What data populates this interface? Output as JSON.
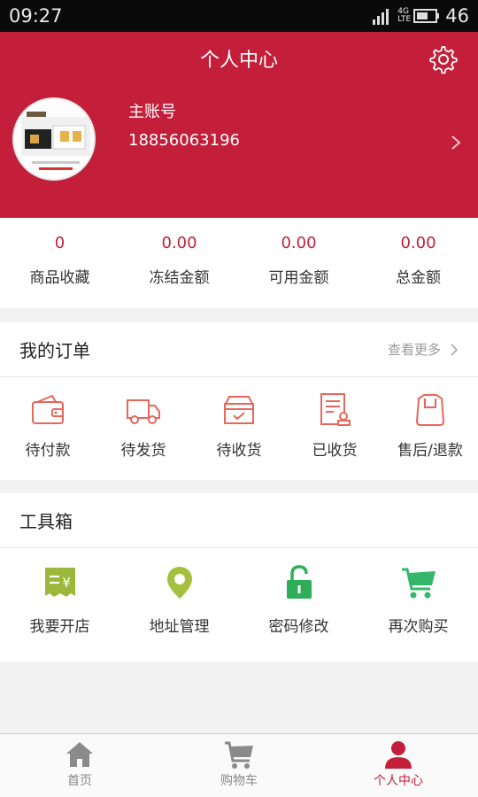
{
  "status_bar": {
    "time": "09:27",
    "network": "4G LTE",
    "battery": "46"
  },
  "header": {
    "title": "个人中心",
    "account_label": "主账号",
    "phone": "18856063196"
  },
  "stats": [
    {
      "value": "0",
      "label": "商品收藏"
    },
    {
      "value": "0.00",
      "label": "冻结金额"
    },
    {
      "value": "0.00",
      "label": "可用金额"
    },
    {
      "value": "0.00",
      "label": "总金额"
    }
  ],
  "orders": {
    "title": "我的订单",
    "more": "查看更多",
    "items": [
      {
        "label": "待付款",
        "icon": "wallet-icon"
      },
      {
        "label": "待发货",
        "icon": "truck-icon"
      },
      {
        "label": "待收货",
        "icon": "box-icon"
      },
      {
        "label": "已收货",
        "icon": "receipt-icon"
      },
      {
        "label": "售后/退款",
        "icon": "return-bag-icon"
      }
    ]
  },
  "tools": {
    "title": "工具箱",
    "items": [
      {
        "label": "我要开店",
        "icon": "shop-receipt-icon"
      },
      {
        "label": "地址管理",
        "icon": "location-pin-icon"
      },
      {
        "label": "密码修改",
        "icon": "lock-icon"
      },
      {
        "label": "再次购买",
        "icon": "cart-icon"
      }
    ]
  },
  "tabbar": [
    {
      "label": "首页",
      "icon": "home-icon"
    },
    {
      "label": "购物车",
      "icon": "cart-icon"
    },
    {
      "label": "个人中心",
      "icon": "user-icon"
    }
  ],
  "colors": {
    "brand": "#c31f3a",
    "order_icon": "#e8665a",
    "shop_icon": "#9bb83a",
    "pin_icon": "#a5bf3f",
    "lock_icon": "#2fae59",
    "cart_icon": "#35b76b"
  }
}
